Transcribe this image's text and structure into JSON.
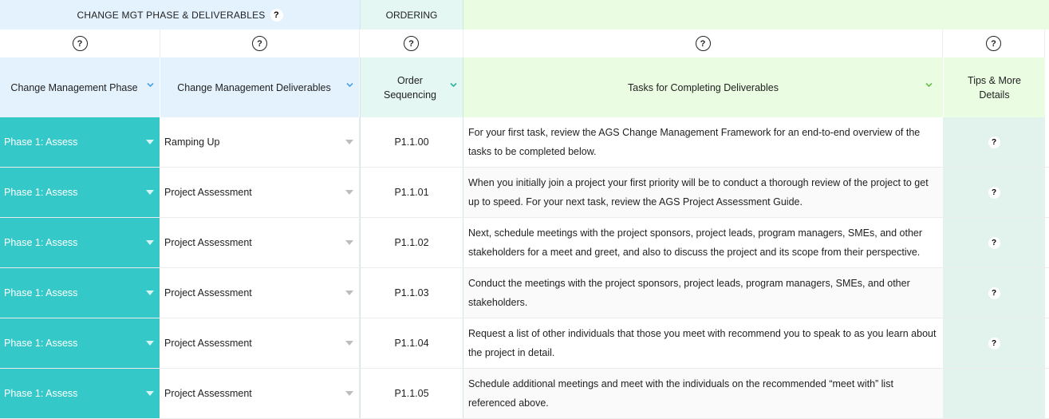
{
  "group_headers": {
    "change_mgt": "CHANGE MGT PHASE & DELIVERABLES",
    "ordering": "ORDERING",
    "help_glyph": "?"
  },
  "help_row": {
    "glyph": "?"
  },
  "columns": {
    "phase": "Change Management Phase",
    "deliverables": "Change Management Deliverables",
    "order_line1": "Order",
    "order_line2": "Sequencing",
    "tasks": "Tasks for Completing Deliverables",
    "tips_line1": "Tips & More",
    "tips_line2": "Details"
  },
  "colors": {
    "phase_cell": "#35c8c9",
    "group_blue": "#e3f2fd",
    "group_teal": "#e5f7f3",
    "group_green": "#eafde3",
    "tips_cell": "#e1f3ec"
  },
  "icons": {
    "dropdown": "chevron-down-icon",
    "help": "question-circle-icon"
  },
  "rows": [
    {
      "phase": "Phase 1: Assess",
      "deliverable": "Ramping Up",
      "order": "P1.1.00",
      "task": "For your first task, review the AGS Change Management Framework for an end-to-end overview of the tasks to be completed below.",
      "tips": "?"
    },
    {
      "phase": "Phase 1: Assess",
      "deliverable": "Project Assessment",
      "order": "P1.1.01",
      "task": "When you initially join a project your first priority will be to conduct a thorough review of the project to get up to speed. For your next task, review the AGS Project Assessment Guide.",
      "tips": "?"
    },
    {
      "phase": "Phase 1: Assess",
      "deliverable": "Project Assessment",
      "order": "P1.1.02",
      "task": "Next, schedule meetings with the project sponsors, project leads, program managers, SMEs, and other stakeholders for a meet and greet, and also to discuss the project and its scope from their perspective.",
      "tips": "?"
    },
    {
      "phase": "Phase 1: Assess",
      "deliverable": "Project Assessment",
      "order": "P1.1.03",
      "task": "Conduct the meetings with the project sponsors, project leads, program managers, SMEs, and other stakeholders.",
      "tips": "?"
    },
    {
      "phase": "Phase 1: Assess",
      "deliverable": "Project Assessment",
      "order": "P1.1.04",
      "task": "Request a list of other individuals that those you meet with recommend you to speak to as you learn about the project in detail.",
      "tips": "?"
    },
    {
      "phase": "Phase 1: Assess",
      "deliverable": "Project Assessment",
      "order": "P1.1.05",
      "task": "Schedule additional meetings and meet with the individuals on the recommended “meet with” list referenced above.",
      "tips": ""
    }
  ]
}
